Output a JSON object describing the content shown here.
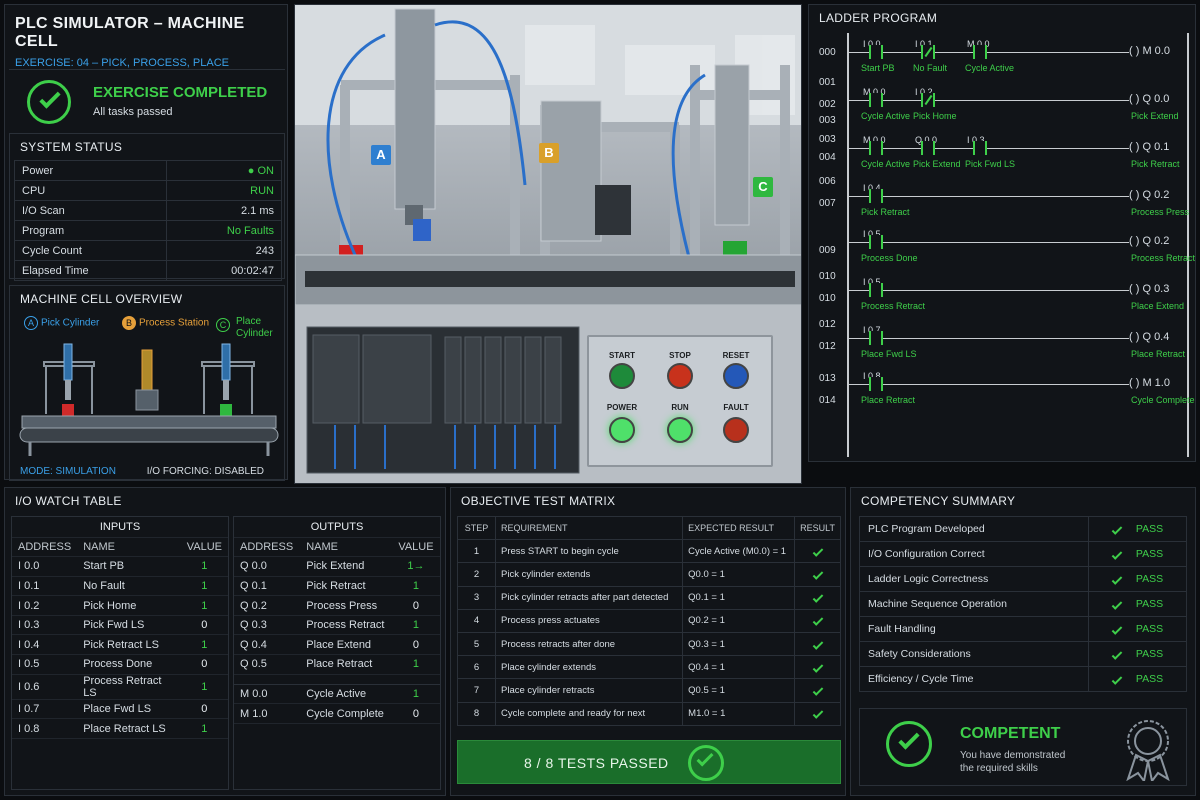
{
  "header": {
    "title": "PLC SIMULATOR – MACHINE CELL",
    "exercise": "EXERCISE: 04 – PICK, PROCESS, PLACE"
  },
  "status_banner": {
    "title": "EXERCISE COMPLETED",
    "subtitle": "All tasks passed"
  },
  "system_status": {
    "title": "SYSTEM STATUS",
    "rows": [
      {
        "label": "Power",
        "value": "● ON"
      },
      {
        "label": "CPU",
        "value": "RUN"
      },
      {
        "label": "I/O Scan",
        "value": "2.1 ms"
      },
      {
        "label": "Program",
        "value": "No Faults"
      },
      {
        "label": "Cycle Count",
        "value": "243"
      },
      {
        "label": "Elapsed Time",
        "value": "00:02:47"
      }
    ]
  },
  "overview": {
    "title": "MACHINE CELL OVERVIEW",
    "legend": [
      {
        "letter": "A",
        "label": "Pick Cylinder"
      },
      {
        "letter": "B",
        "label": "Process Station"
      },
      {
        "letter": "C",
        "label": "Place Cylinder"
      }
    ],
    "mode": "MODE: SIMULATION",
    "forcing": "I/O FORCING: DISABLED"
  },
  "photo": {
    "tags": [
      "A",
      "B",
      "C"
    ],
    "buttons": [
      "START",
      "STOP",
      "RESET",
      "POWER",
      "RUN",
      "FAULT"
    ]
  },
  "ladder": {
    "title": "LADDER PROGRAM",
    "rung_numbers": [
      "000",
      "001",
      "002",
      "003",
      "003",
      "004",
      "006",
      "007",
      "009",
      "010",
      "010",
      "012",
      "012",
      "013",
      "014"
    ],
    "rungs": [
      {
        "contacts": [
          {
            "addr": "I 0.0",
            "label": "Start PB",
            "nc": false
          },
          {
            "addr": "I 0.1",
            "label": "No Fault",
            "nc": true
          },
          {
            "addr": "M 0.0",
            "label": "Cycle Active",
            "nc": false
          }
        ],
        "coil": "M 0.0",
        "coil_label": ""
      },
      {
        "contacts": [
          {
            "addr": "M 0.0",
            "label": "Cycle Active",
            "nc": false
          },
          {
            "addr": "I 0.2",
            "label": "Pick Home",
            "nc": true
          }
        ],
        "coil": "Q 0.0",
        "coil_label": "Pick Extend"
      },
      {
        "contacts": [
          {
            "addr": "M 0.0",
            "label": "Cycle Active",
            "nc": false
          },
          {
            "addr": "Q 0.0",
            "label": "Pick Extend",
            "nc": false
          },
          {
            "addr": "I 0.3",
            "label": "Pick Fwd LS",
            "nc": false
          }
        ],
        "coil": "Q 0.1",
        "coil_label": "Pick Retract"
      },
      {
        "contacts": [
          {
            "addr": "I 0.4",
            "label": "Pick Retract",
            "nc": false
          }
        ],
        "coil": "Q 0.2",
        "coil_label": "Process Press"
      },
      {
        "contacts": [
          {
            "addr": "I 0.5",
            "label": "Process Done",
            "nc": false
          }
        ],
        "coil": "Q 0.2",
        "coil_label": "Process Retract"
      },
      {
        "contacts": [
          {
            "addr": "I 0.5",
            "label": "Process Retract",
            "nc": false
          }
        ],
        "coil": "Q 0.3",
        "coil_label": "Place Extend"
      },
      {
        "contacts": [
          {
            "addr": "I 0.7",
            "label": "Place Fwd LS",
            "nc": false
          }
        ],
        "coil": "Q 0.4",
        "coil_label": "Place Retract"
      },
      {
        "contacts": [
          {
            "addr": "I 0.8",
            "label": "Place Retract",
            "nc": false
          }
        ],
        "coil": "M 1.0",
        "coil_label": "Cycle Complete"
      }
    ]
  },
  "io": {
    "title": "I/O WATCH TABLE",
    "inputs_title": "INPUTS",
    "outputs_title": "OUTPUTS",
    "columns": [
      "ADDRESS",
      "NAME",
      "VALUE"
    ],
    "inputs": [
      {
        "addr": "I 0.0",
        "name": "Start PB",
        "value": "1"
      },
      {
        "addr": "I 0.1",
        "name": "No Fault",
        "value": "1"
      },
      {
        "addr": "I 0.2",
        "name": "Pick Home",
        "value": "1"
      },
      {
        "addr": "I 0.3",
        "name": "Pick Fwd LS",
        "value": "0"
      },
      {
        "addr": "I 0.4",
        "name": "Pick Retract LS",
        "value": "1"
      },
      {
        "addr": "I 0.5",
        "name": "Process Done",
        "value": "0"
      },
      {
        "addr": "I 0.6",
        "name": "Process Retract LS",
        "value": "1"
      },
      {
        "addr": "I 0.7",
        "name": "Place Fwd LS",
        "value": "0"
      },
      {
        "addr": "I 0.8",
        "name": "Place Retract LS",
        "value": "1"
      }
    ],
    "outputs": [
      {
        "addr": "Q 0.0",
        "name": "Pick Extend",
        "value": "1→"
      },
      {
        "addr": "Q 0.1",
        "name": "Pick Retract",
        "value": "1"
      },
      {
        "addr": "Q 0.2",
        "name": "Process Press",
        "value": "0"
      },
      {
        "addr": "Q 0.3",
        "name": "Process Retract",
        "value": "1"
      },
      {
        "addr": "Q 0.4",
        "name": "Place Extend",
        "value": "0"
      },
      {
        "addr": "Q 0.5",
        "name": "Place Retract",
        "value": "1"
      }
    ],
    "memory": [
      {
        "addr": "M 0.0",
        "name": "Cycle Active",
        "value": "1"
      },
      {
        "addr": "M 1.0",
        "name": "Cycle Complete",
        "value": "0"
      }
    ]
  },
  "objective": {
    "title": "OBJECTIVE TEST MATRIX",
    "columns": [
      "STEP",
      "REQUIREMENT",
      "EXPECTED RESULT",
      "RESULT"
    ],
    "rows": [
      {
        "step": "1",
        "req": "Press START to begin cycle",
        "exp": "Cycle Active (M0.0) = 1"
      },
      {
        "step": "2",
        "req": "Pick cylinder extends",
        "exp": "Q0.0 = 1"
      },
      {
        "step": "3",
        "req": "Pick cylinder retracts after part detected",
        "exp": "Q0.1 = 1"
      },
      {
        "step": "4",
        "req": "Process press actuates",
        "exp": "Q0.2 = 1"
      },
      {
        "step": "5",
        "req": "Process retracts after done",
        "exp": "Q0.3 = 1"
      },
      {
        "step": "6",
        "req": "Place cylinder extends",
        "exp": "Q0.4 = 1"
      },
      {
        "step": "7",
        "req": "Place cylinder retracts",
        "exp": "Q0.5 = 1"
      },
      {
        "step": "8",
        "req": "Cycle complete and ready for next",
        "exp": "M1.0 = 1"
      }
    ],
    "summary": "8 / 8 TESTS PASSED"
  },
  "competency": {
    "title": "COMPETENCY SUMMARY",
    "rows": [
      {
        "label": "PLC Program Developed",
        "result": "PASS"
      },
      {
        "label": "I/O Configuration Correct",
        "result": "PASS"
      },
      {
        "label": "Ladder Logic Correctness",
        "result": "PASS"
      },
      {
        "label": "Machine Sequence Operation",
        "result": "PASS"
      },
      {
        "label": "Fault Handling",
        "result": "PASS"
      },
      {
        "label": "Safety Considerations",
        "result": "PASS"
      },
      {
        "label": "Efficiency / Cycle Time",
        "result": "PASS"
      }
    ],
    "badge_title": "COMPETENT",
    "badge_sub": "You have demonstrated the required skills"
  },
  "colors": {
    "accent_green": "#3ecf4a",
    "accent_blue": "#3aa0e8",
    "accent_orange": "#e6a03a",
    "panel_bg": "#111418",
    "pass_bar": "#1a6e2a"
  }
}
